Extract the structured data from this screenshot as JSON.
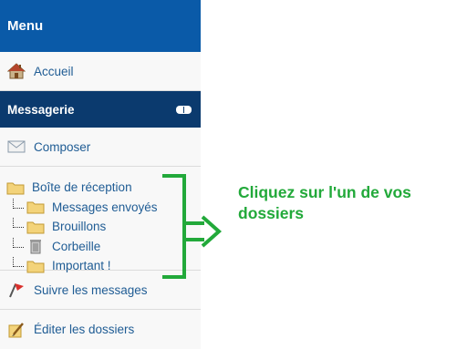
{
  "sidebar": {
    "menu_title": "Menu",
    "home_label": "Accueil",
    "messaging_title": "Messagerie",
    "compose_label": "Composer",
    "folders": [
      {
        "label": "Boîte de réception",
        "icon": "folder-icon",
        "level": 0
      },
      {
        "label": "Messages envoyés",
        "icon": "folder-icon",
        "level": 1
      },
      {
        "label": "Brouillons",
        "icon": "folder-icon",
        "level": 1
      },
      {
        "label": "Corbeille",
        "icon": "trash-icon",
        "level": 1
      },
      {
        "label": "Important !",
        "icon": "folder-icon",
        "level": 1
      }
    ],
    "follow_label": "Suivre les messages",
    "edit_folders_label": "Éditer les dossiers"
  },
  "annotation": {
    "text": "Cliquez sur l'un de vos dossiers",
    "color": "#22a93a"
  },
  "colors": {
    "menu_header": "#0a5aa8",
    "section_header": "#0b3a6e",
    "link": "#1f5c94"
  }
}
